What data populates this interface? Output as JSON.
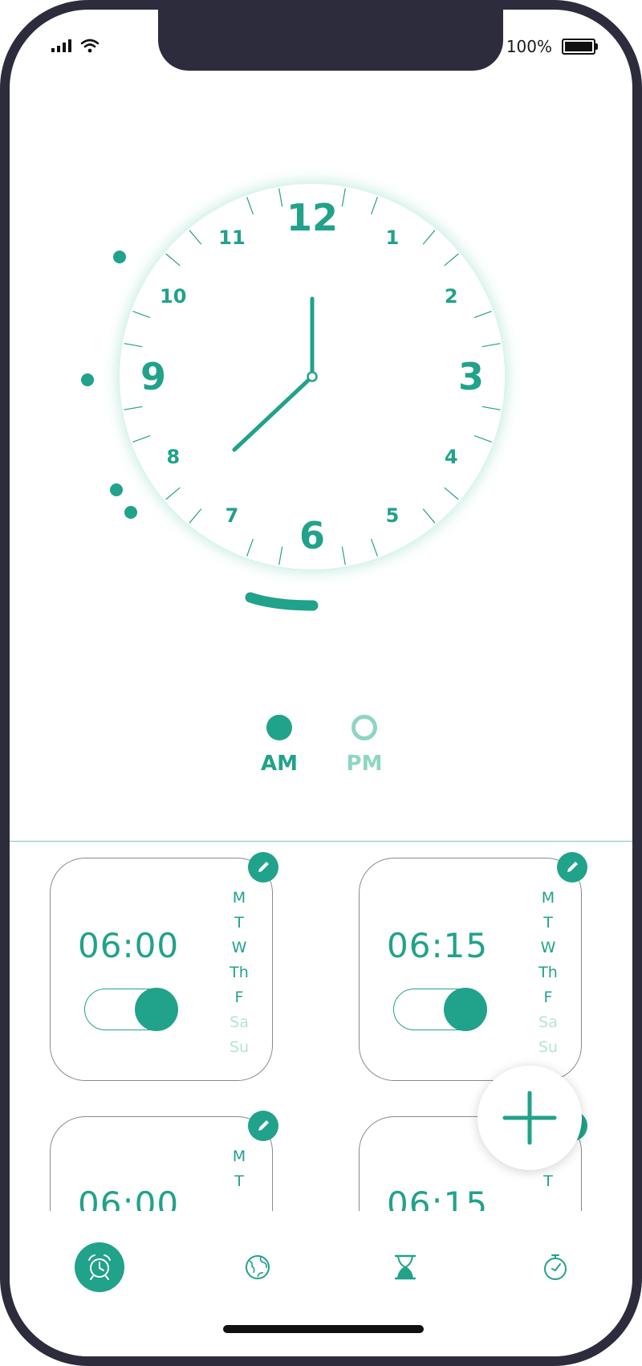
{
  "status_bar": {
    "battery_text": "100%"
  },
  "clock": {
    "numerals": [
      "12",
      "1",
      "2",
      "3",
      "4",
      "5",
      "6",
      "7",
      "8",
      "9",
      "10",
      "11"
    ],
    "time_shown": "7:00",
    "colors": {
      "accent": "#21a28a",
      "glow": "#bfeadf"
    }
  },
  "period_selector": {
    "am_label": "AM",
    "pm_label": "PM",
    "selected": "AM"
  },
  "alarms": [
    {
      "time": "06:00",
      "enabled": true,
      "days": [
        {
          "label": "M",
          "active": true
        },
        {
          "label": "T",
          "active": true
        },
        {
          "label": "W",
          "active": true
        },
        {
          "label": "Th",
          "active": true
        },
        {
          "label": "F",
          "active": true
        },
        {
          "label": "Sa",
          "active": false
        },
        {
          "label": "Su",
          "active": false
        }
      ]
    },
    {
      "time": "06:15",
      "enabled": true,
      "days": [
        {
          "label": "M",
          "active": true
        },
        {
          "label": "T",
          "active": true
        },
        {
          "label": "W",
          "active": true
        },
        {
          "label": "Th",
          "active": true
        },
        {
          "label": "F",
          "active": true
        },
        {
          "label": "Sa",
          "active": false
        },
        {
          "label": "Su",
          "active": false
        }
      ]
    },
    {
      "time": "06:00",
      "enabled": true,
      "days": [
        {
          "label": "M",
          "active": true
        },
        {
          "label": "T",
          "active": true
        }
      ]
    },
    {
      "time": "06:15",
      "enabled": true,
      "days": [
        {
          "label": "M",
          "active": true
        },
        {
          "label": "T",
          "active": true
        }
      ]
    }
  ],
  "tabs": [
    {
      "icon": "alarm-clock-icon",
      "active": true
    },
    {
      "icon": "globe-icon",
      "active": false
    },
    {
      "icon": "hourglass-icon",
      "active": false
    },
    {
      "icon": "stopwatch-icon",
      "active": false
    }
  ],
  "fab": {
    "icon": "plus-icon"
  },
  "colors": {
    "accent": "#21a28a",
    "accent_light": "#8fd5c5",
    "inactive_day": "#b7e3d8",
    "frame": "#2c2c3d"
  }
}
